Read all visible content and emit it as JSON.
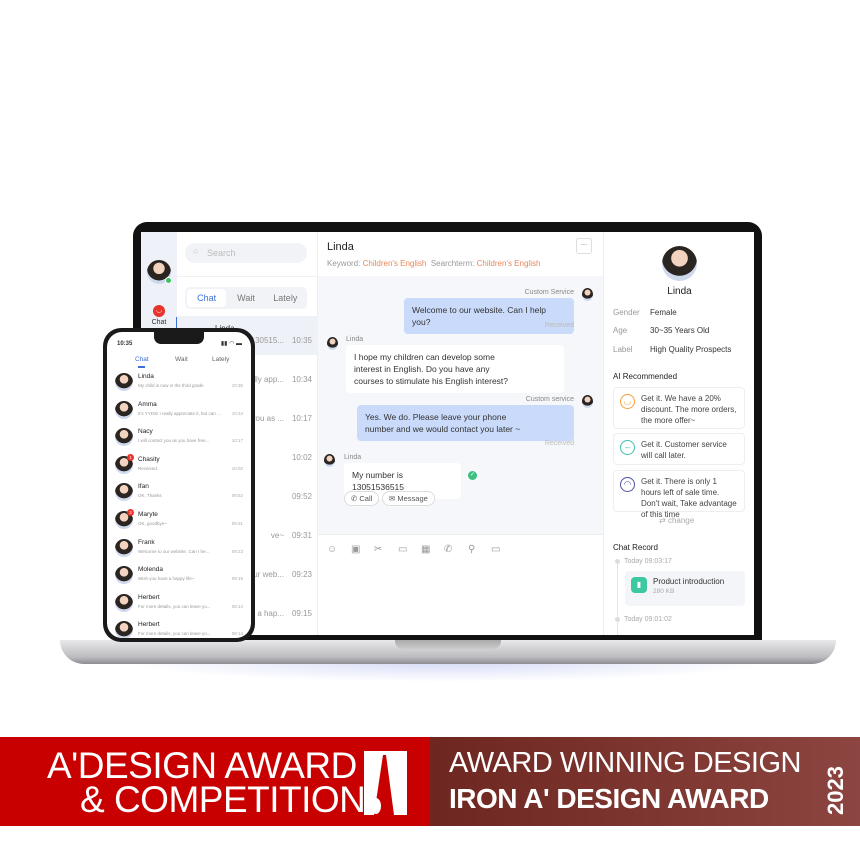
{
  "desktop": {
    "sidebar": {
      "nav_label": "Chat",
      "online_color": "#3cc060"
    },
    "list": {
      "search_placeholder": "Search",
      "tabs": [
        "Chat",
        "Wait",
        "Lately"
      ],
      "items": [
        {
          "name": "Linda",
          "preview": "is 130515...",
          "time": "10:35"
        },
        {
          "name": "Amma",
          "preview": "really app...",
          "time": "10:34"
        },
        {
          "name": "Nacy",
          "preview": "t you as ...",
          "time": "10:17"
        },
        {
          "name": "Chasity",
          "preview": "",
          "time": "10:02"
        },
        {
          "name": "Ifan",
          "preview": "",
          "time": "09:52"
        },
        {
          "name": "Maryte",
          "preview": "ve~",
          "time": "09:31"
        },
        {
          "name": "Frank",
          "preview": "our web...",
          "time": "09:23"
        },
        {
          "name": "Molenda",
          "preview": "ve a hap...",
          "time": "09:15"
        }
      ]
    },
    "chat": {
      "title": "Linda",
      "more": "...",
      "keyword_label": "Keyword:",
      "keyword": "Children's English",
      "searchterm_label": "Searchterm:",
      "searchterm": "Children's English",
      "accent": "#e8875a",
      "messages": [
        {
          "sender": "Custom Service",
          "text": "Welcome to our website. Can I help you?",
          "status": "Received"
        },
        {
          "sender": "Linda",
          "text": "I hope my children can develop some interest in English. Do you have any courses to stimulate his English interest?"
        },
        {
          "sender": "Custom service",
          "text": "Yes. We do. Please leave your phone number and we would contact you later ~",
          "status": "Received"
        },
        {
          "sender": "Linda",
          "text": "My number is 13051536515"
        }
      ],
      "call": "Call",
      "message": "Message",
      "toolbar_icons": [
        "emoji-icon",
        "image-icon",
        "scissors-icon",
        "folder-icon",
        "calendar-icon",
        "phone-icon",
        "microphone-icon",
        "video-icon"
      ]
    },
    "profile": {
      "name": "Linda",
      "fields": [
        {
          "k": "Gender",
          "v": "Female"
        },
        {
          "k": "Age",
          "v": "30~35 Years Old"
        },
        {
          "k": "Label",
          "v": "High Quality Prospects"
        }
      ],
      "ai_title": "AI Recommended",
      "recs": [
        {
          "text": "Get it. We have a 20% discount. The more orders, the more offer~",
          "color": "#f0a040"
        },
        {
          "text": "Get it. Customer service will call later.",
          "color": "#40c0b0"
        },
        {
          "text": "Get it. There is only 1 hours left of sale time. Don't wait, Take advantage of this time",
          "color": "#5050a0"
        }
      ],
      "change": "change",
      "record_title": "Chat Record",
      "records": [
        {
          "time": "Today 09:03:17",
          "file": "Product introduction",
          "size": "280 KB"
        },
        {
          "time": "Today 09:01:02"
        }
      ]
    }
  },
  "phone": {
    "time": "10:35",
    "tabs": [
      "Chat",
      "Wait",
      "Lately"
    ],
    "items": [
      {
        "name": "Linda",
        "msg": "My child is now in the third grade",
        "time": "10:35"
      },
      {
        "name": "Amma",
        "msg": "It's YYDS! I really appreciate it, but can ...",
        "time": "10:34"
      },
      {
        "name": "Nacy",
        "msg": "I will contact you as you have free...",
        "time": "10:17"
      },
      {
        "name": "Chasity",
        "msg": "Received.",
        "time": "10:02",
        "badge": "1"
      },
      {
        "name": "Ifan",
        "msg": "OK, Thanks",
        "time": "09:52"
      },
      {
        "name": "Maryte",
        "msg": "OK, goodbye~",
        "time": "09:31",
        "badge": "3"
      },
      {
        "name": "Frank",
        "msg": "Welcome to our website. Can I he...",
        "time": "09:23"
      },
      {
        "name": "Molenda",
        "msg": "Wish you have a happy life~",
        "time": "09:15"
      },
      {
        "name": "Herbert",
        "msg": "For more details, you can leave yo...",
        "time": "08:14"
      },
      {
        "name": "Herbert",
        "msg": "For more details, you can leave yo...",
        "time": "08:14"
      }
    ]
  },
  "banner": {
    "line1": "A'DESIGN AWARD",
    "line2": "& COMPETITION",
    "award_line1": "AWARD WINNING DESIGN",
    "award_line2": "IRON A' DESIGN AWARD",
    "year": "2023",
    "red": "#c80000",
    "brown": "#7a302a"
  }
}
